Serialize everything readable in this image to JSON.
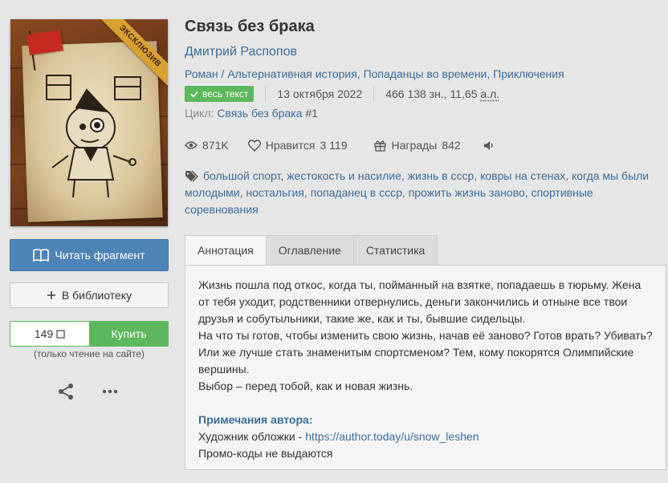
{
  "book": {
    "title": "Связь без брака",
    "author": "Дмитрий Распопов",
    "cover_badge": "ЭКСКЛЮЗИВ",
    "genres": {
      "form": "Роман",
      "items": [
        "Альтернативная история",
        "Попаданцы во времени",
        "Приключения"
      ]
    },
    "full_text_badge": "весь текст",
    "date": "13 октября 2022",
    "size": "466 138 зн., 11,65",
    "size_unit": "а.л.",
    "cycle_label": "Цикл:",
    "cycle_name": "Связь без брака",
    "cycle_num": "#1"
  },
  "stats": {
    "views": "871K",
    "likes_label": "Нравится",
    "likes": "3 119",
    "awards_label": "Награды",
    "awards": "842"
  },
  "tags": [
    "большой спорт",
    "жестокость и насилие",
    "жизнь в ссср",
    "ковры на стенах",
    "когда мы были молодыми",
    "ностальгия",
    "попаданец в ссср",
    "прожить жизнь заново",
    "спортивные соревнования"
  ],
  "actions": {
    "read_fragment": "Читать фрагмент",
    "add_library": "В библиотеку",
    "price": "149",
    "buy": "Купить",
    "buy_note": "(только чтение на сайте)"
  },
  "tabs": [
    "Аннотация",
    "Оглавление",
    "Статистика"
  ],
  "annotation": {
    "paragraphs": [
      "Жизнь пошла под откос, когда ты, пойманный на взятке, попадаешь в тюрьму. Жена от тебя уходит, родственники отвернулись, деньги закончились и отныне все твои друзья и собутыльники, такие же, как и ты, бывшие сидельцы.",
      "На что ты готов, чтобы изменить свою жизнь, начав её заново? Готов врать? Убивать? Или же лучше стать знаменитым спортсменом? Тем, кому покорятся Олимпийские вершины.",
      "Выбор – перед тобой, как и новая жизнь."
    ],
    "notes_title": "Примечания автора:",
    "artist_label": "Художник обложки - ",
    "artist_link": "https://author.today/u/snow_leshen",
    "promo": "Промо-коды не выдаются"
  },
  "colors": {
    "link": "#3d6d9a",
    "primary_button": "#4d83b7",
    "green": "#5cb85c",
    "background": "#e6e6e6"
  },
  "icons": [
    "book-icon",
    "plus-icon",
    "share-icon",
    "more-icon",
    "eye-icon",
    "heart-icon",
    "gift-icon",
    "speaker-icon",
    "tag-icon",
    "check-icon",
    "card-icon"
  ]
}
